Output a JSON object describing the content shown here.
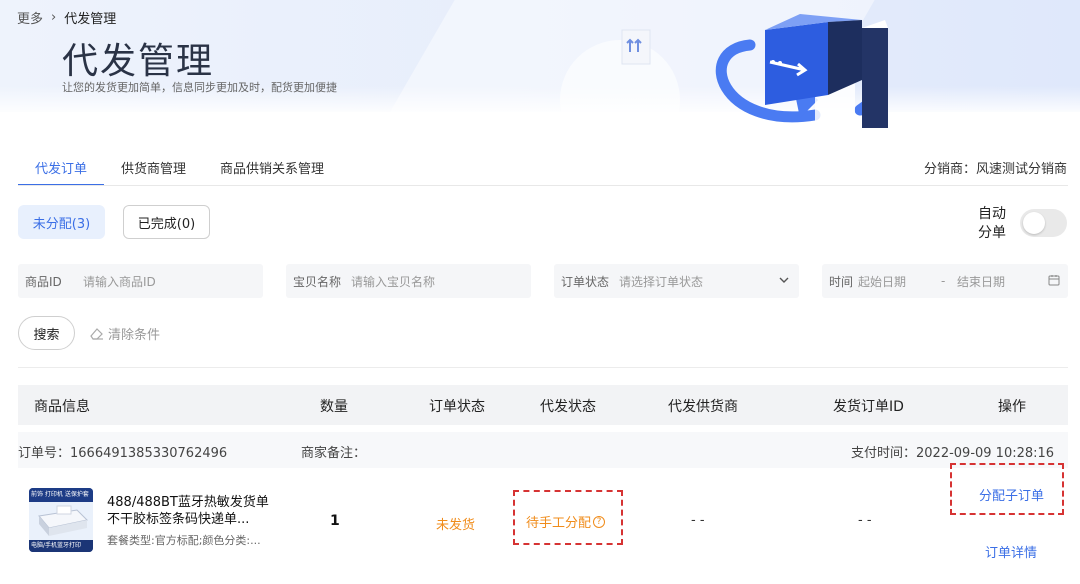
{
  "breadcrumb": {
    "parent": "更多",
    "separator": "›",
    "current": "代发管理"
  },
  "header": {
    "title": "代发管理",
    "subtitle": "让您的发货更加简单，信息同步更加及时，配货更加便捷"
  },
  "tabs": [
    {
      "label": "代发订单",
      "active": true
    },
    {
      "label": "供货商管理",
      "active": false
    },
    {
      "label": "商品供销关系管理",
      "active": false
    }
  ],
  "distributor": "分销商：风速测试分销商",
  "status_filters": {
    "unassigned": "未分配(3)",
    "completed": "已完成(0)"
  },
  "auto_assign": {
    "label": "自动分单",
    "enabled": false
  },
  "filters": {
    "product_id": {
      "label": "商品ID",
      "placeholder": "请输入商品ID"
    },
    "item_name": {
      "label": "宝贝名称",
      "placeholder": "请输入宝贝名称"
    },
    "order_status": {
      "label": "订单状态",
      "placeholder": "请选择订单状态"
    },
    "time": {
      "label": "时间",
      "start": "起始日期",
      "dash": "-",
      "end": "结束日期"
    }
  },
  "actions": {
    "search": "搜索",
    "clear": "清除条件"
  },
  "table": {
    "columns": [
      "商品信息",
      "数量",
      "订单状态",
      "代发状态",
      "代发供货商",
      "发货订单ID",
      "操作"
    ],
    "orders": [
      {
        "order_no": "订单号：1666491385330762496",
        "merchant_note": "商家备注：",
        "pay_time": "支付时间：2022-09-09 10:28:16",
        "thumb_top": "前饰 打印机 送保护套",
        "thumb_bottom": "电脑/手机蓝牙打印",
        "title": "488/488BT蓝牙热敏发货单不干胶标签条码快递单...",
        "sku": "套餐类型:官方标配;颜色分类:...",
        "quantity": "1",
        "order_status": "未发货",
        "dispatch_status": "待手工分配",
        "supplier": "- -",
        "ship_order_id": "- -",
        "action_assign": "分配子订单",
        "action_detail": "订单详情"
      }
    ]
  },
  "colors": {
    "accent": "#3b6fe6",
    "warning": "#f08c1b",
    "highlight_border": "#d63333"
  }
}
